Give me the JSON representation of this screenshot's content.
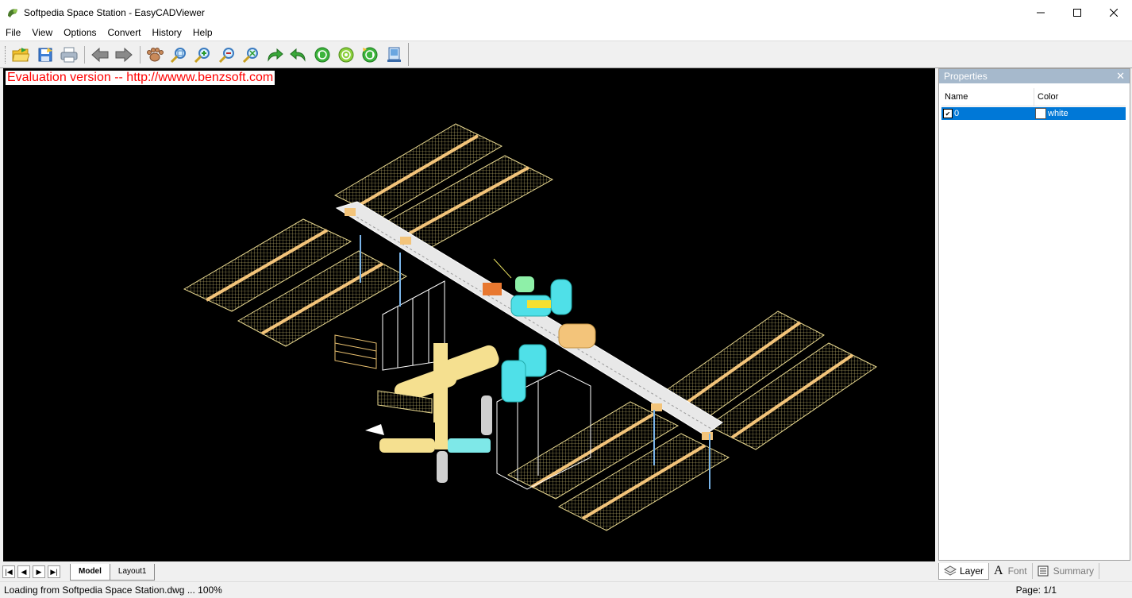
{
  "window": {
    "title": "Softpedia Space Station - EasyCADViewer"
  },
  "menu": [
    "File",
    "View",
    "Options",
    "Convert",
    "History",
    "Help"
  ],
  "toolbar": {
    "buttons": [
      "open-icon",
      "save-icon",
      "print-icon",
      "back-icon",
      "forward-icon",
      "pan-icon",
      "zoom-window-icon",
      "zoom-in-icon",
      "zoom-out-icon",
      "zoom-extents-icon",
      "redo-icon",
      "undo-icon",
      "rotate-left-icon",
      "rotate-center-icon",
      "rotate-right-icon",
      "export-icon"
    ]
  },
  "canvas": {
    "eval_text": "Evaluation version -- http://wwww.benzsoft.com",
    "background": "#000000"
  },
  "sheet_tabs": {
    "model": "Model",
    "layout1": "Layout1"
  },
  "properties": {
    "title": "Properties",
    "columns": {
      "name": "Name",
      "color": "Color"
    },
    "row": {
      "name": "0",
      "color": "white",
      "checked": true
    },
    "tabs": {
      "layer": "Layer",
      "font": "Font",
      "summary": "Summary"
    }
  },
  "status": {
    "left": "Loading from Softpedia Space Station.dwg ... 100%",
    "right": "Page: 1/1"
  },
  "colors": {
    "selection": "#0078d7",
    "panel_header": "#a6b9cc",
    "eval_text": "#ff0000"
  }
}
